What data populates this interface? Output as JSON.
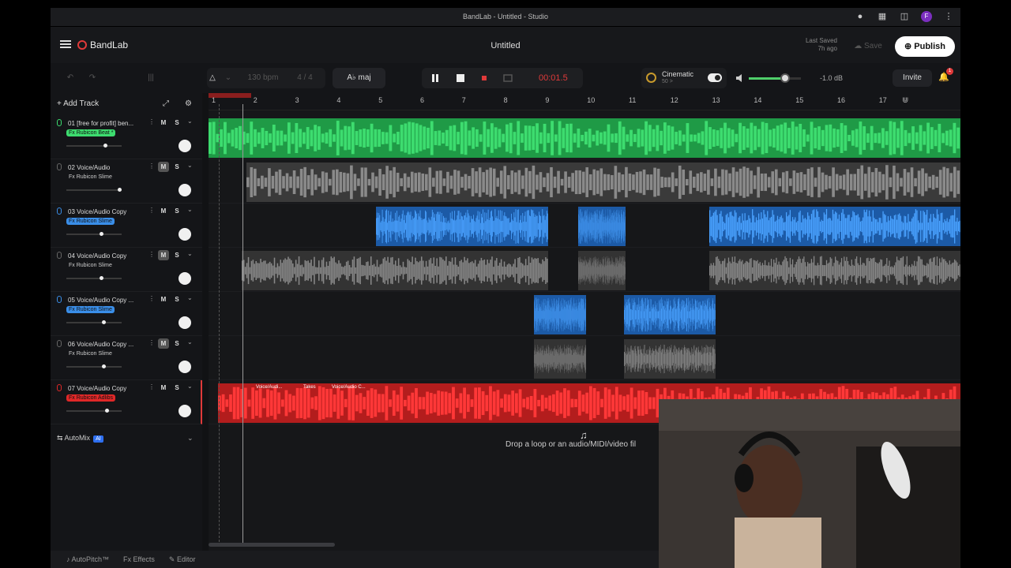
{
  "window": {
    "title": "BandLab - Untitled - Studio"
  },
  "header": {
    "app_name": "BandLab",
    "project_title": "Untitled",
    "last_saved_label": "Last Saved",
    "last_saved_time": "7h ago",
    "save_label": "Save",
    "publish_label": "Publish",
    "invite_label": "Invite",
    "notification_count": "1"
  },
  "toolbar": {
    "bpm": "130 bpm",
    "time_sig": "4 / 4",
    "key": "A♭ maj",
    "time": "00:01.5",
    "preset_name": "Cinematic",
    "preset_value": "50 >",
    "master_db": "-1.0 dB",
    "master_volume_fraction": 0.7
  },
  "sidebar": {
    "add_track_label": "Add Track",
    "tracks": [
      {
        "name": "01  [free for profit] ben...",
        "fx": "Fx Rubicon Beat *",
        "color": "#3ddc6f",
        "volume": 0.93,
        "muted": false
      },
      {
        "name": "02  Voice/Audio",
        "fx": "Fx Rubicon Slime",
        "color": "#888888",
        "volume": 1.3,
        "muted": true
      },
      {
        "name": "03  Voice/Audio Copy",
        "fx": "Fx Rubicon Slime",
        "color": "#3a8ee8",
        "volume": 0.84,
        "muted": false
      },
      {
        "name": "04  Voice/Audio Copy",
        "fx": "Fx Rubicon Slime",
        "color": "#888888",
        "volume": 0.84,
        "muted": true
      },
      {
        "name": "05  Voice/Audio Copy ...",
        "fx": "Fx Rubicon Slime",
        "color": "#3a8ee8",
        "volume": 0.89,
        "muted": false
      },
      {
        "name": "06  Voice/Audio Copy ...",
        "fx": "Fx Rubicon Slime",
        "color": "#888888",
        "volume": 0.89,
        "muted": true
      },
      {
        "name": "07  Voice/Audio Copy",
        "fx": "Fx Rubicon Adlibs",
        "color": "#e02828",
        "volume": 0.97,
        "muted": false
      }
    ],
    "automix_label": "AutoMix",
    "ai_badge": "AI"
  },
  "ruler": {
    "bars": [
      "1",
      "2",
      "3",
      "4",
      "5",
      "6",
      "7",
      "8",
      "9",
      "10",
      "11",
      "12",
      "13",
      "14",
      "15",
      "16",
      "17"
    ]
  },
  "clips": {
    "takes_label": "Takes",
    "clip_name_a": "Voice/Audi...",
    "clip_name_b": "Voice/Audio C..."
  },
  "drop_zone": {
    "text": "Drop a loop or an audio/MIDI/video fil"
  },
  "bottom": {
    "autopitch": "AutoPitch™",
    "effects": "Effects",
    "editor": "Editor"
  },
  "icons": [
    "menu-icon",
    "undo-icon",
    "redo-icon",
    "metronome-icon",
    "pause-icon",
    "stop-icon",
    "record-icon",
    "loop-icon",
    "speaker-icon",
    "bell-icon",
    "globe-icon",
    "mic-icon",
    "magnet-icon",
    "zoom-icon"
  ],
  "colors": {
    "accent_red": "#e03a3a",
    "green_track": "#3ddc6f",
    "blue_track": "#3a8ee8",
    "gray_track": "#888888"
  }
}
